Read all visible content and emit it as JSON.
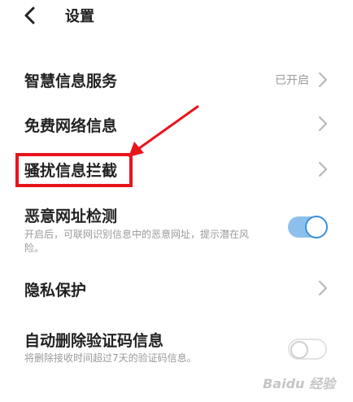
{
  "header": {
    "title": "设置"
  },
  "rows": [
    {
      "title": "智慧信息服务",
      "status": "已开启"
    },
    {
      "title": "免费网络信息"
    },
    {
      "title": "骚扰信息拦截"
    },
    {
      "title": "恶意网址检测",
      "subtitle": "开启后，可联网识别信息中的恶意网址，提示潜在风险。",
      "toggle": "on"
    },
    {
      "title": "隐私保护"
    },
    {
      "title": "自动删除验证码信息",
      "subtitle": "将删除接收时间超过7天的验证码信息。",
      "toggle": "off"
    }
  ],
  "colors": {
    "accent": "#3a8fd8",
    "toggle_on_track": "#8cc0ec",
    "annotation": "#e8141c"
  },
  "watermark": "Baidu 经验"
}
